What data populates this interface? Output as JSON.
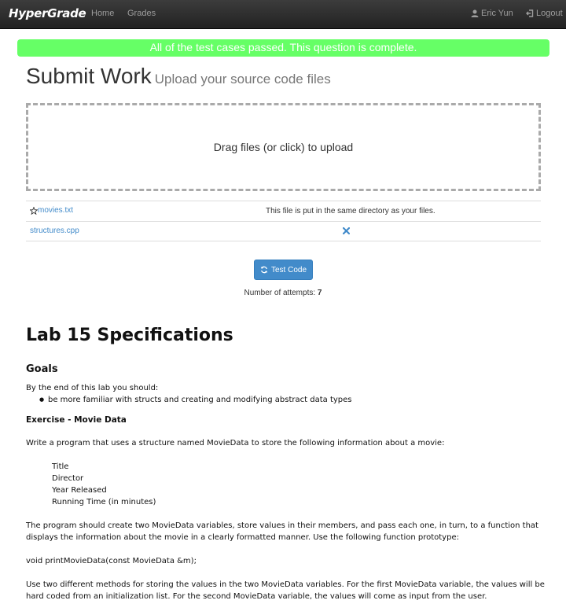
{
  "navbar": {
    "brand": "HyperGrade",
    "links": [
      "Home",
      "Grades"
    ],
    "user": "Eric Yun",
    "logout": "Logout"
  },
  "alert": {
    "text": "All of the test cases passed. This question is complete."
  },
  "header": {
    "title": "Submit Work",
    "subtitle": "Upload your source code files"
  },
  "dropzone": {
    "text": "Drag files (or click) to upload"
  },
  "files": [
    {
      "name": "movies.txt",
      "note": "This file is put in the same directory as your files."
    },
    {
      "name": "structures.cpp"
    }
  ],
  "actions": {
    "test_code": "Test Code",
    "attempts_label": "Number of attempts:",
    "attempts_value": "7"
  },
  "spec": {
    "title": "Lab 15 Specifications",
    "goals_heading": "Goals",
    "goals_intro": "By the end of this lab you should:",
    "goals": [
      "be more familiar with structs and creating and modifying abstract data types"
    ],
    "exercise_heading": "Exercise - Movie Data",
    "p1": "Write a program that uses a structure named MovieData to store the following information about a movie:",
    "fields": [
      "Title",
      "Director",
      "Year Released",
      "Running Time (in minutes)"
    ],
    "p2": "The program should create two MovieData variables, store values in their members, and pass each one, in turn, to a function that displays the information about the movie in a clearly formatted manner.  Use the following function prototype:",
    "prototype": "void printMovieData(const MovieData &m);",
    "p3": "Use two different methods for storing the values in the two MovieData variables.  For the first MovieData variable, the values will be hard coded from an initialization list.  For the second MovieData variable, the values will come as input from the user."
  },
  "colors": {
    "alert_bg": "#66ff66",
    "primary": "#428bca",
    "navbar": "#222222"
  }
}
